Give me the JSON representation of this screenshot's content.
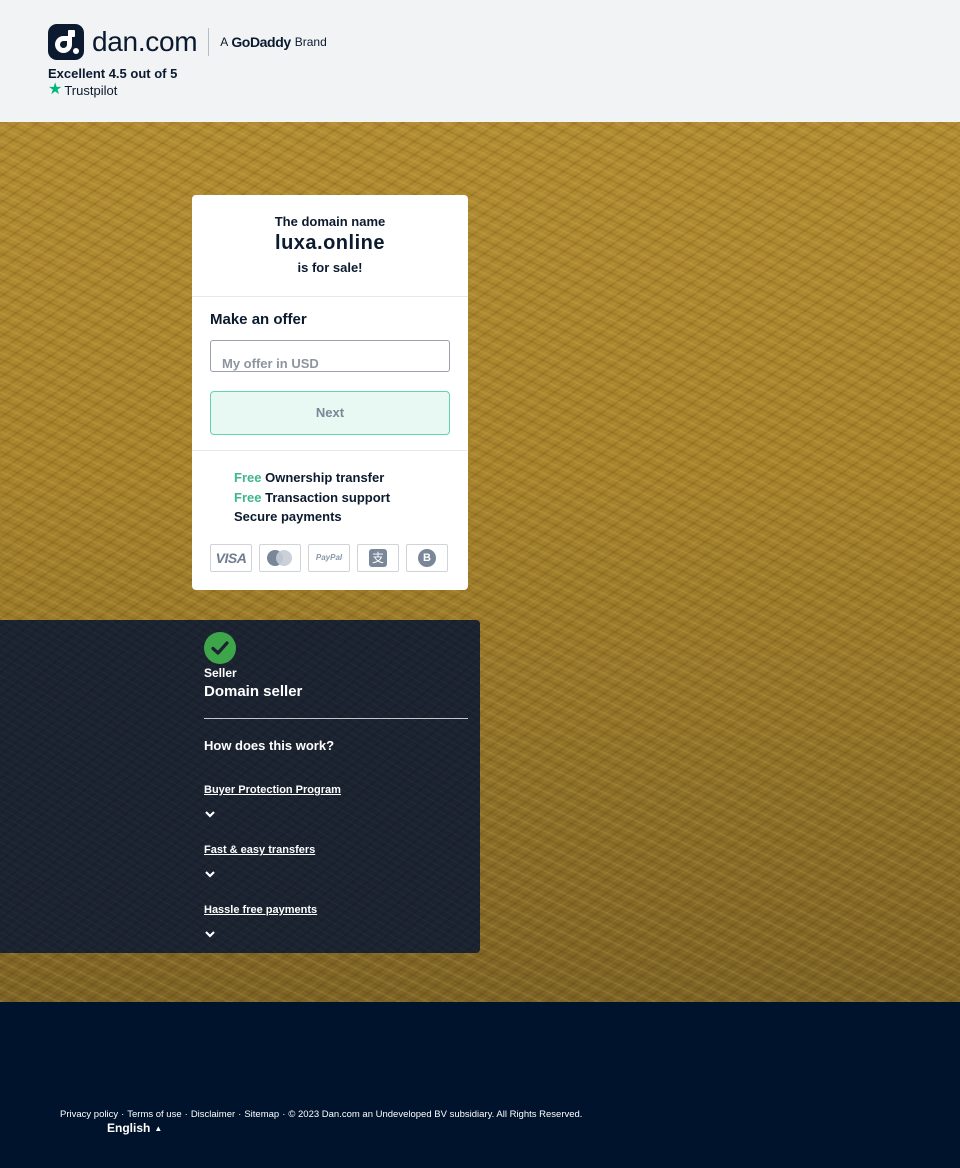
{
  "header": {
    "logo_text": "dan.com",
    "brand_prefix": "A",
    "brand_name": "GoDaddy",
    "brand_suffix": "Brand",
    "rating_text": "Excellent 4.5 out of 5",
    "trustpilot_label": "Trustpilot"
  },
  "sale_card": {
    "heading": "The domain name",
    "domain": "luxa.online",
    "subheading": "is for sale!",
    "offer_title": "Make an offer",
    "offer_placeholder": "My offer in USD",
    "offer_value": "",
    "next_label": "Next",
    "features": [
      {
        "prefix": "Free",
        "text": "Ownership transfer"
      },
      {
        "prefix": "Free",
        "text": "Transaction support"
      },
      {
        "prefix": "",
        "text": "Secure payments"
      }
    ],
    "payment_methods": [
      {
        "name": "visa",
        "label": "VISA"
      },
      {
        "name": "mastercard",
        "label": ""
      },
      {
        "name": "paypal",
        "label": "PayPal"
      },
      {
        "name": "alipay",
        "label": "支"
      },
      {
        "name": "bitcoin",
        "label": "B"
      }
    ]
  },
  "seller_panel": {
    "verified_icon": "check-circle-icon",
    "seller_label": "Seller",
    "seller_name": "Domain seller",
    "how_title": "How does this work?",
    "accordion": [
      {
        "label": "Buyer Protection Program"
      },
      {
        "label": "Fast & easy transfers"
      },
      {
        "label": "Hassle free payments"
      }
    ]
  },
  "footer": {
    "links": [
      "Privacy policy",
      "Terms of use",
      "Disclaimer",
      "Sitemap"
    ],
    "separator": "·",
    "copyright": "© 2023 Dan.com an Undeveloped BV subsidiary. All Rights Reserved.",
    "language": "English",
    "language_caret": "▲"
  },
  "colors": {
    "brand_navy": "#0b1a2e",
    "accent_green": "#3fb68b",
    "check_green": "#3ea64a",
    "footer_bg": "#00132c",
    "gold_bg": "#a7832c"
  }
}
